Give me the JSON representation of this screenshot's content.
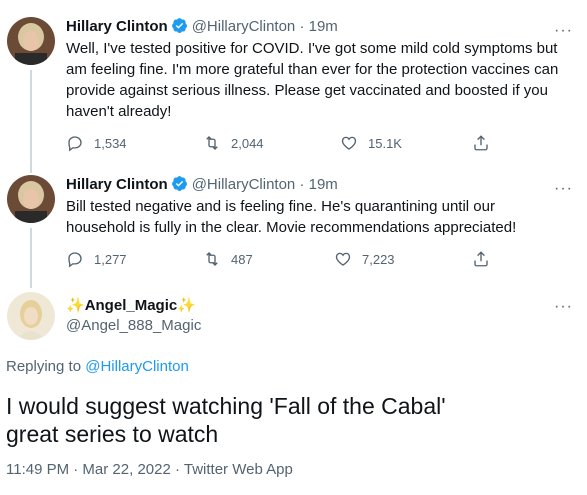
{
  "tweets": [
    {
      "name": "Hillary Clinton",
      "handle": "@HillaryClinton",
      "dot": "·",
      "time": "19m",
      "text": "Well, I've tested positive for COVID. I've got some mild cold symptoms but am feeling fine. I'm more grateful than ever for the protection vaccines can provide against serious illness. Please get vaccinated and boosted if you haven't already!",
      "replies": "1,534",
      "retweets": "2,044",
      "likes": "15.1K"
    },
    {
      "name": "Hillary Clinton",
      "handle": "@HillaryClinton",
      "dot": "·",
      "time": "19m",
      "text": "Bill tested negative and is feeling fine. He's quarantining until our household is fully in the clear. Movie recommendations appreciated!",
      "replies": "1,277",
      "retweets": "487",
      "likes": "7,223"
    }
  ],
  "reply": {
    "sparkle_left": "✨",
    "name": "Angel_Magic",
    "sparkle_right": "✨",
    "handle": "@Angel_888_Magic",
    "replying_prefix": "Replying to",
    "replying_to": "@HillaryClinton",
    "text_line1": "I would suggest watching 'Fall of the Cabal'",
    "text_line2": "great series to watch",
    "meta": "11:49 PM · Mar 22, 2022 · Twitter Web App"
  },
  "more_icon": "···",
  "colors": {
    "verified": "#1d9bf0",
    "link": "#1d9bf0",
    "muted": "#536471"
  }
}
